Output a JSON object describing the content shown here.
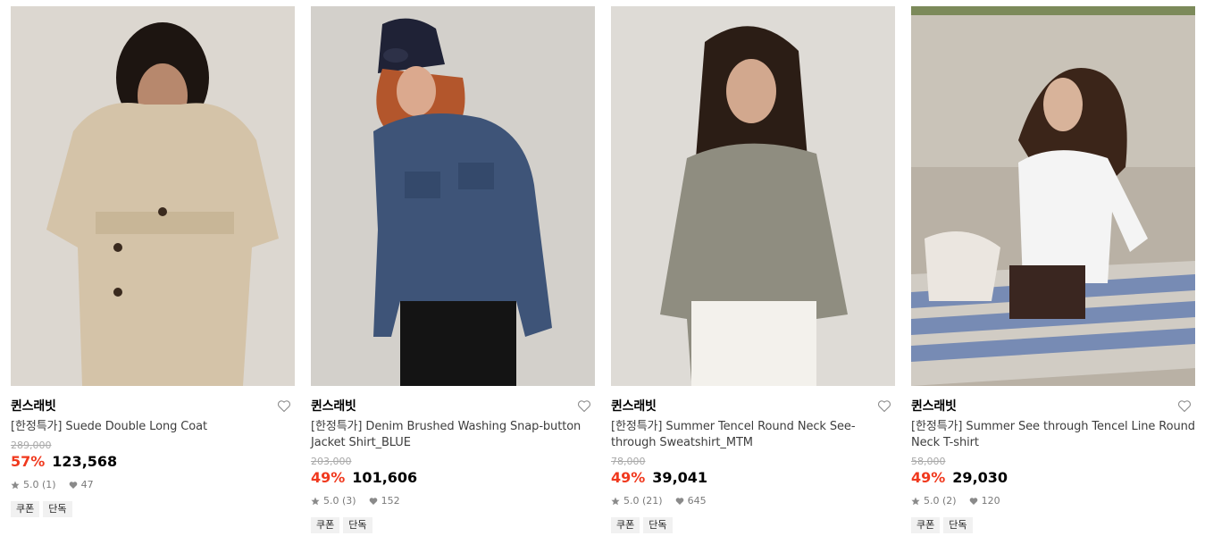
{
  "products": [
    {
      "brand": "퀸스래빗",
      "name": "[한정특가] Suede Double Long Coat",
      "original_price": "289,000",
      "discount": "57%",
      "price": "123,568",
      "rating": "5.0 (1)",
      "likes": "47",
      "tags": [
        "쿠폰",
        "단독"
      ],
      "image_colors": {
        "bg": "#d9d4cd",
        "item": "#d5c5ab",
        "hair": "#1c1410"
      }
    },
    {
      "brand": "퀸스래빗",
      "name": "[한정특가] Denim Brushed Washing Snap-button Jacket Shirt_BLUE",
      "original_price": "203,000",
      "discount": "49%",
      "price": "101,606",
      "rating": "5.0 (3)",
      "likes": "152",
      "tags": [
        "쿠폰",
        "단독"
      ],
      "image_colors": {
        "bg": "#d3d0cb",
        "item": "#3c5276",
        "hair": "#b0542b"
      }
    },
    {
      "brand": "퀸스래빗",
      "name": "[한정특가] Summer Tencel Round Neck See-through Sweatshirt_MTM",
      "original_price": "78,000",
      "discount": "49%",
      "price": "39,041",
      "rating": "5.0 (21)",
      "likes": "645",
      "tags": [
        "쿠폰",
        "단독"
      ],
      "image_colors": {
        "bg": "#dedbd6",
        "item": "#8f8d80",
        "hair": "#2a1c14"
      }
    },
    {
      "brand": "퀸스래빗",
      "name": "[한정특가] Summer See through Tencel Line Round Neck T-shirt",
      "original_price": "58,000",
      "discount": "49%",
      "price": "29,030",
      "rating": "5.0 (2)",
      "likes": "120",
      "tags": [
        "쿠폰",
        "단독"
      ],
      "image_colors": {
        "bg": "#c9c3b8",
        "item": "#f4f4f4",
        "hair": "#3a2418"
      }
    }
  ],
  "colors": {
    "discount": "#f0391e",
    "muted": "#a9a9a9",
    "tag_bg": "#f1f1f1"
  }
}
